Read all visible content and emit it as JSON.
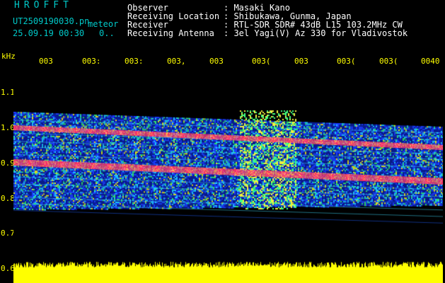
{
  "header": {
    "app_title": "HROFFT",
    "filename": "UT2509190030.pn",
    "meteor_label": "meteor",
    "datetime": "25.09.19 00:30",
    "count": "0.."
  },
  "station": [
    {
      "key": "Observer",
      "value": ": Masaki Kano"
    },
    {
      "key": "Receiving Location",
      "value": ": Shibukawa, Gunma, Japan"
    },
    {
      "key": "Receiver",
      "value": ": RTL-SDR SDR# 43dB L15 103.2MHz CW"
    },
    {
      "key": "Receiving Antenna",
      "value": ": 3el Yagi(V) Az 330 for Vladivostok"
    }
  ],
  "axis": {
    "unit": "kHz",
    "x_ticks": [
      "003",
      "003:",
      "003:",
      "003,",
      "003",
      "003(",
      "003",
      "003(",
      "003(",
      "0040"
    ],
    "y_ticks": [
      "1.1",
      "1.0",
      "0.9",
      "0.8",
      "0.7",
      "0.6"
    ]
  },
  "colors": {
    "background": "#000000",
    "label_cyan": "#00c8c8",
    "text_white": "#ffffff",
    "axis_yellow": "#ffff00",
    "signal_red": "#ff3366",
    "noise_blue": "#1a3cff"
  }
}
